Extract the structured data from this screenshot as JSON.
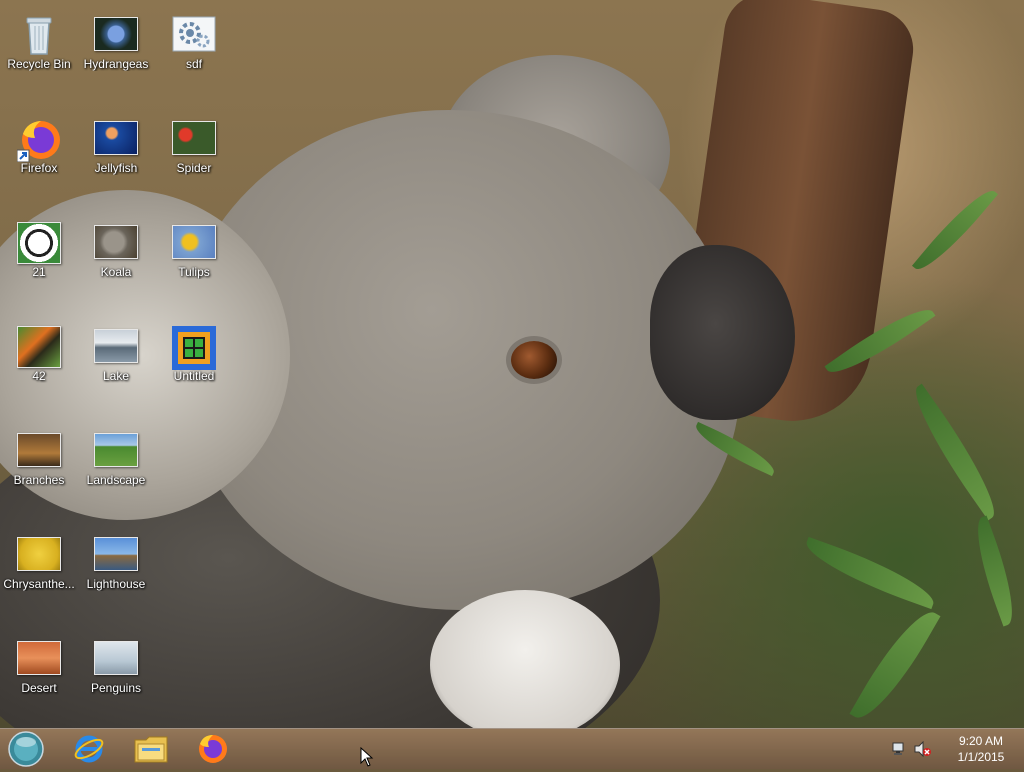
{
  "desktop": {
    "icons": [
      {
        "label": "Recycle Bin",
        "icon": "recycle-bin-icon"
      },
      {
        "label": "Hydrangeas",
        "icon": "hydrangeas-thumbnail"
      },
      {
        "label": "sdf",
        "icon": "settings-file-icon"
      },
      {
        "label": "Firefox",
        "icon": "firefox-icon"
      },
      {
        "label": "Jellyfish",
        "icon": "jellyfish-thumbnail"
      },
      {
        "label": "Spider",
        "icon": "spider-thumbnail"
      },
      {
        "label": "21",
        "icon": "soccer-ball-icon"
      },
      {
        "label": "Koala",
        "icon": "koala-thumbnail"
      },
      {
        "label": "Tulips",
        "icon": "tulips-thumbnail"
      },
      {
        "label": "42",
        "icon": "butterfly-icon"
      },
      {
        "label": "Lake",
        "icon": "lake-thumbnail"
      },
      {
        "label": "Untitled",
        "icon": "untitled-app-icon"
      },
      {
        "label": "Branches",
        "icon": "branches-thumbnail"
      },
      {
        "label": "Landscape",
        "icon": "landscape-thumbnail"
      },
      {
        "label": "Chrysanthe...",
        "icon": "chrysanthemum-thumbnail"
      },
      {
        "label": "Lighthouse",
        "icon": "lighthouse-thumbnail"
      },
      {
        "label": "Desert",
        "icon": "desert-thumbnail"
      },
      {
        "label": "Penguins",
        "icon": "penguins-thumbnail"
      }
    ]
  },
  "taskbar": {
    "start": {
      "icon": "start-orb-icon"
    },
    "pinned": [
      {
        "icon": "internet-explorer-icon"
      },
      {
        "icon": "file-explorer-icon"
      },
      {
        "icon": "firefox-icon"
      }
    ],
    "tray": {
      "network_icon": "network-icon",
      "volume_icon": "volume-muted-icon",
      "time": "9:20 AM",
      "date": "1/1/2015"
    }
  },
  "colors": {
    "label_text": "#ffffff",
    "taskbar": "#8a6c50"
  }
}
